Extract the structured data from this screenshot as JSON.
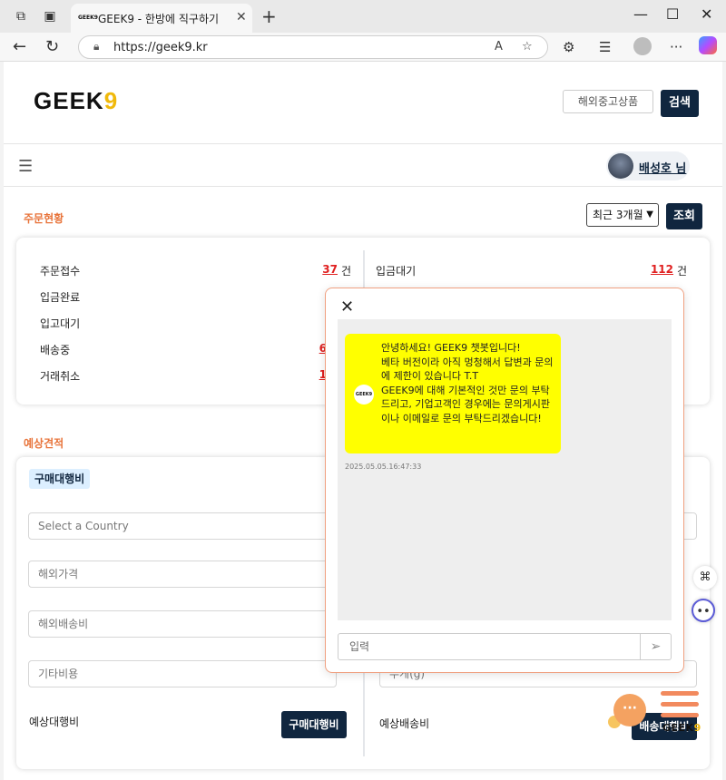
{
  "browser": {
    "tab_title": "GEEK9 - 한방에 직구하기",
    "url": "https://geek9.kr",
    "icons": [
      "workspaces-icon",
      "tab-actions-icon",
      "close-icon",
      "plus-icon",
      "back-icon",
      "refresh-icon",
      "lock-icon",
      "read-aloud-icon",
      "favorite-icon",
      "extensions-icon",
      "favorites-bar-icon",
      "profile-icon",
      "more-icon",
      "copilot-icon"
    ]
  },
  "header": {
    "logo_text": "GEEK",
    "logo_nine": "9",
    "used_goods_button": "해외중고상품",
    "search_button": "검색"
  },
  "nav": {
    "user_name": "배성호 님"
  },
  "orders": {
    "title": "주문현황",
    "period": "최근 3개월",
    "query_button": "조회",
    "left": [
      {
        "label": "주문접수",
        "count": "37",
        "unit": "건"
      },
      {
        "label": "입금완료",
        "count": "",
        "unit": ""
      },
      {
        "label": "입고대기",
        "count": "",
        "unit": ""
      },
      {
        "label": "배송중",
        "count": "6",
        "unit": ""
      },
      {
        "label": "거래취소",
        "count": "1",
        "unit": ""
      }
    ],
    "right": [
      {
        "label": "입금대기",
        "count": "112",
        "unit": "건"
      }
    ]
  },
  "estimate": {
    "title": "예상견적",
    "badge": "구매대행비",
    "country_placeholder": "Select a Country",
    "foreign_price": "해외가격",
    "foreign_shipping": "해외배송비",
    "other_cost": "기타비용",
    "weight": "무게(g)",
    "estimated_fee_label": "예상대행비",
    "fee_button": "구매대행비",
    "estimated_shipping_label": "예상배송비",
    "shipping_button": "배송대행비"
  },
  "chat": {
    "bot_avatar_text": "GEEK9",
    "message": "안녕하세요! GEEK9 챗봇입니다!\n베타 버전이라 아직 멍청해서 답변과 문의에 제한이 있습니다 T.T\nGEEK9에 대해 기본적인 것만 문의 부탁드리고, 기업고객인 경우에는 문의게시판이나 이메일로 문의 부탁드리겠습니다!",
    "timestamp": "2025.05.05.16:47:33",
    "input_placeholder": "입력"
  },
  "floating": {
    "chat_fab_text": "···",
    "geek9_text": "GEEK",
    "geek9_nine": "9"
  }
}
